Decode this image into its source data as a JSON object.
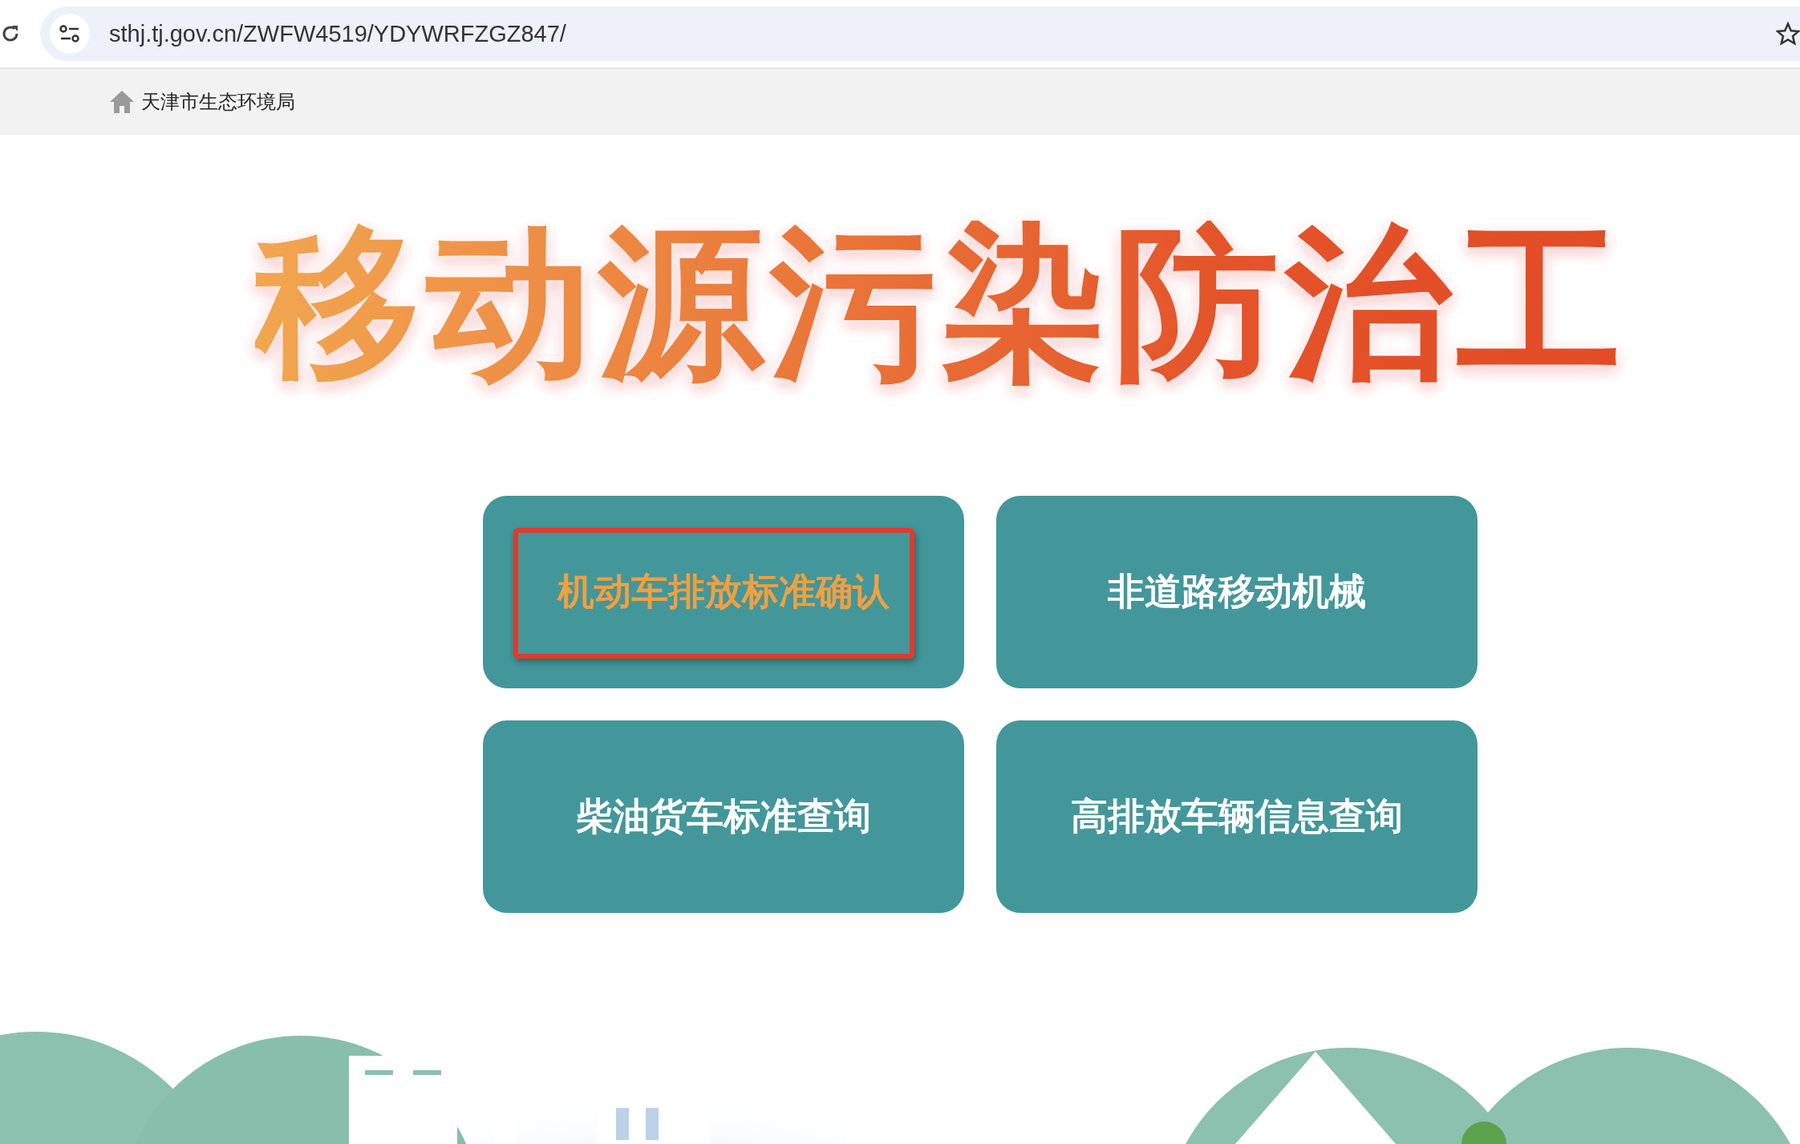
{
  "browser": {
    "url": "sthj.tj.gov.cn/ZWFW4519/YDYWRFZGZ847/"
  },
  "breadcrumb": {
    "label": "天津市生态环境局"
  },
  "banner": {
    "title": "移动源污染防治工"
  },
  "menu": [
    {
      "label": "机动车排放标准确认",
      "selected": true
    },
    {
      "label": "非道路移动机械",
      "selected": false
    },
    {
      "label": "柴油货车标准查询",
      "selected": false
    },
    {
      "label": "高排放车辆信息查询",
      "selected": false
    }
  ]
}
